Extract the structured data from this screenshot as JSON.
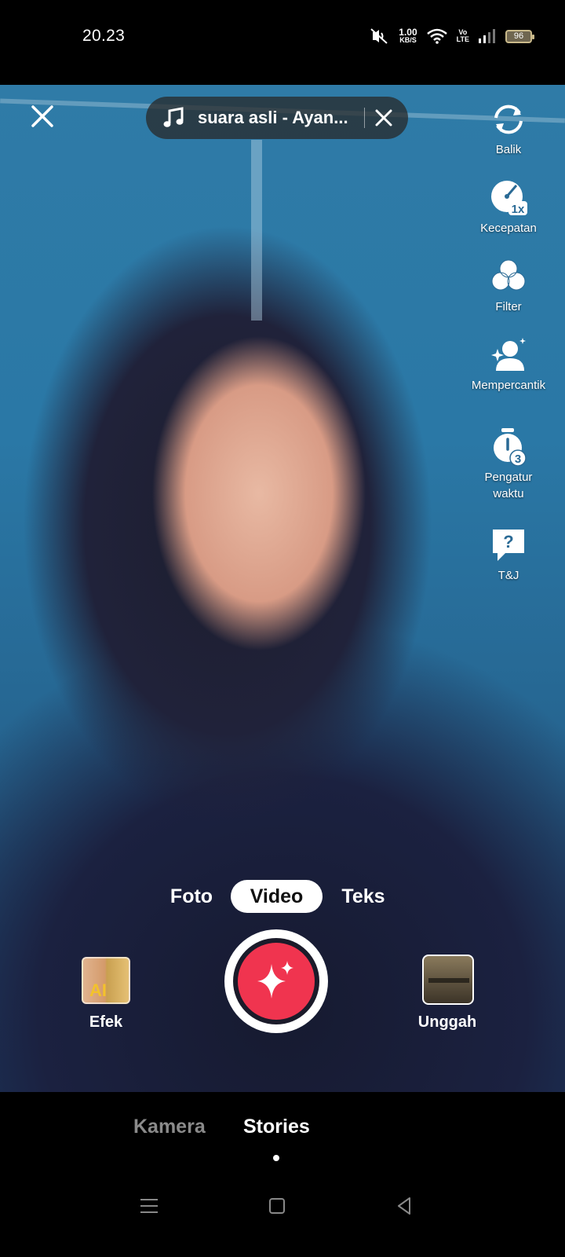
{
  "status_bar": {
    "time": "20.23",
    "net_speed_value": "1.00",
    "net_speed_unit": "KB/S",
    "volte_top": "Vo",
    "volte_bottom": "LTE",
    "battery": "96"
  },
  "top": {
    "music_title": "suara asli - Ayan..."
  },
  "toolbar": {
    "flip": "Balik",
    "speed": "Kecepatan",
    "speed_badge": "1x",
    "filter": "Filter",
    "beautify": "Mempercantik",
    "timer_line1": "Pengatur",
    "timer_line2": "waktu",
    "timer_badge": "3",
    "qa": "T&J"
  },
  "modes": {
    "photo": "Foto",
    "video": "Video",
    "text": "Teks",
    "active": "Video"
  },
  "controls": {
    "effects_label": "Efek",
    "effects_thumb_text": "AI",
    "upload_label": "Unggah"
  },
  "tabs": {
    "camera": "Kamera",
    "stories": "Stories",
    "active": "Stories"
  },
  "colors": {
    "record": "#f0344f",
    "battery": "#c9b98a"
  }
}
